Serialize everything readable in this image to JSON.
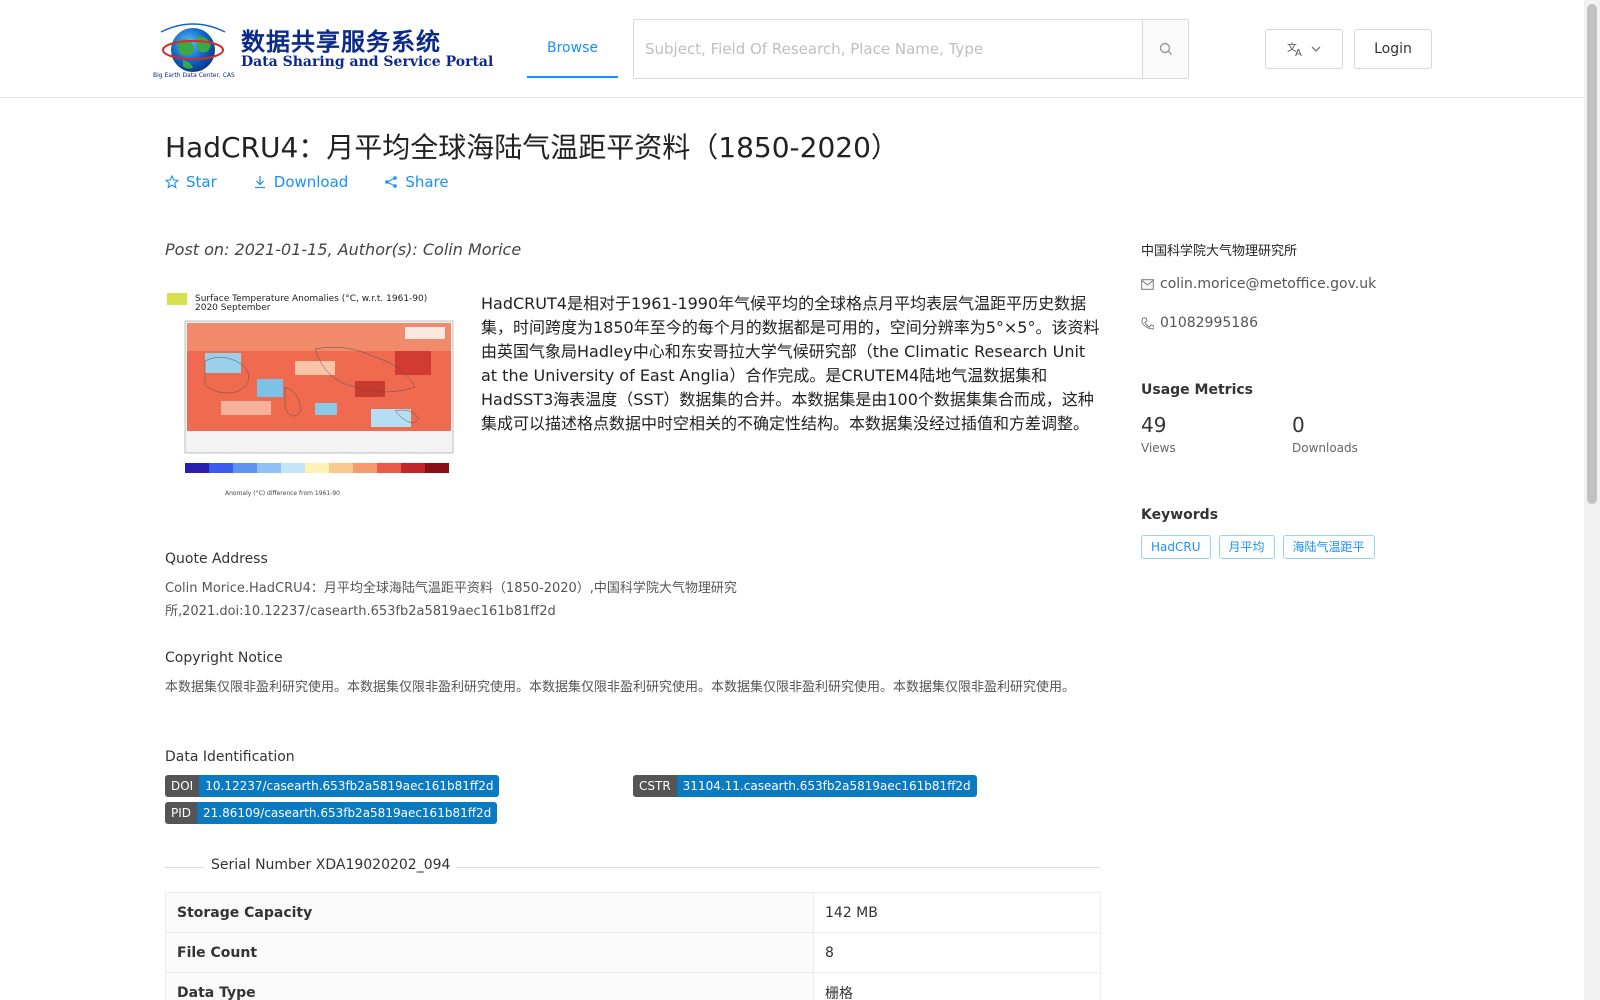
{
  "header": {
    "logo_cn": "数据共享服务系统",
    "logo_en": "Data Sharing and Service Portal",
    "logo_small": "Big Earth Data Center, CAS",
    "nav_browse": "Browse",
    "search_placeholder": "Subject, Field Of Research, Place Name, Type",
    "lang_icon": "translate-icon",
    "login": "Login"
  },
  "dataset": {
    "title": "HadCRU4：月平均全球海陆气温距平资料（1850-2020）",
    "actions": {
      "star": "Star",
      "download": "Download",
      "share": "Share"
    },
    "post_info": "Post on: 2021-01-15, Author(s): Colin Morice",
    "thumbnail": {
      "title": "Surface Temperature Anomalies (°C, w.r.t. 1961-90)",
      "subtitle": "2020 September",
      "caption": "Anomaly (°C) difference from 1961-90"
    },
    "description": "HadCRUT4是相对于1961-1990年气候平均的全球格点月平均表层气温距平历史数据集，时间跨度为1850年至今的每个月的数据都是可用的，空间分辨率为5°×5°。该资料由英国气象局Hadley中心和东安哥拉大学气候研究部（the Climatic Research Unit at the University of East Anglia）合作完成。是CRUTEM4陆地气温数据集和HadSST3海表温度（SST）数据集的合并。本数据集是由100个数据集集合而成，这种集成可以描述格点数据中时空相关的不确定性结构。本数据集没经过插值和方差调整。",
    "quote_label": "Quote Address",
    "quote_text": "Colin Morice.HadCRU4：月平均全球海陆气温距平资料（1850-2020）,中国科学院大气物理研究所,2021.doi:10.12237/casearth.653fb2a5819aec161b81ff2d",
    "copyright_label": "Copyright Notice",
    "copyright_text": "本数据集仅限非盈利研究使用。本数据集仅限非盈利研究使用。本数据集仅限非盈利研究使用。本数据集仅限非盈利研究使用。本数据集仅限非盈利研究使用。",
    "identification_label": "Data Identification",
    "doi_key": "DOI",
    "doi_value": "10.12237/casearth.653fb2a5819aec161b81ff2d",
    "cstr_key": "CSTR",
    "cstr_value": "31104.11.casearth.653fb2a5819aec161b81ff2d",
    "pid_key": "PID",
    "pid_value": "21.86109/casearth.653fb2a5819aec161b81ff2d",
    "serial": "Serial Number XDA19020202_094",
    "table": [
      {
        "key": "Storage Capacity",
        "value": "142 MB"
      },
      {
        "key": "File Count",
        "value": "8"
      },
      {
        "key": "Data Type",
        "value": "栅格"
      }
    ]
  },
  "sidebar": {
    "organization": "中国科学院大气物理研究所",
    "email": "colin.morice@metoffice.gov.uk",
    "phone": "01082995186",
    "metrics_title": "Usage Metrics",
    "views_count": "49",
    "views_label": "Views",
    "downloads_count": "0",
    "downloads_label": "Downloads",
    "keywords_title": "Keywords",
    "keywords": [
      "HadCRU",
      "月平均",
      "海陆气温距平"
    ]
  },
  "colors": {
    "accent": "#1890ff",
    "badge_key": "#555555",
    "badge_value": "#0a7bc3"
  }
}
